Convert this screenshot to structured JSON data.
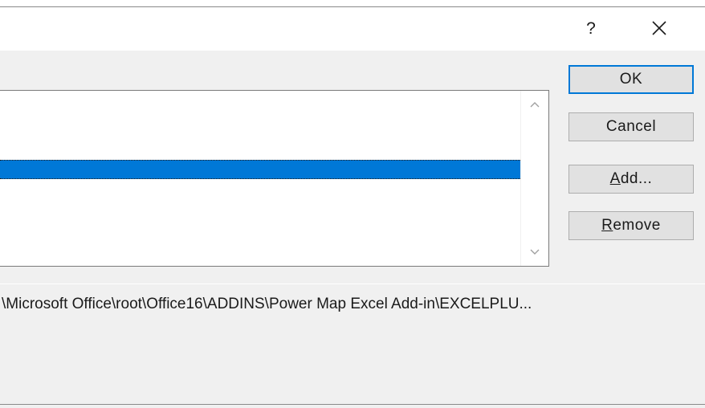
{
  "titlebar": {
    "help_label": "?",
    "close_icon": "close-icon"
  },
  "listbox": {
    "selected_item_label": "",
    "scroll_up_icon": "chevron-up-icon",
    "scroll_down_icon": "chevron-down-icon"
  },
  "buttons": {
    "ok_label": "OK",
    "cancel_label": "Cancel",
    "add_label_accel": "A",
    "add_label_rest": "dd...",
    "remove_label_accel": "R",
    "remove_label_rest": "emove"
  },
  "path": {
    "text": "\\Microsoft Office\\root\\Office16\\ADDINS\\Power Map Excel Add-in\\EXCELPLU..."
  },
  "colors": {
    "accent": "#0078d7",
    "background": "#f0f0f0",
    "button_face": "#e1e1e1"
  }
}
